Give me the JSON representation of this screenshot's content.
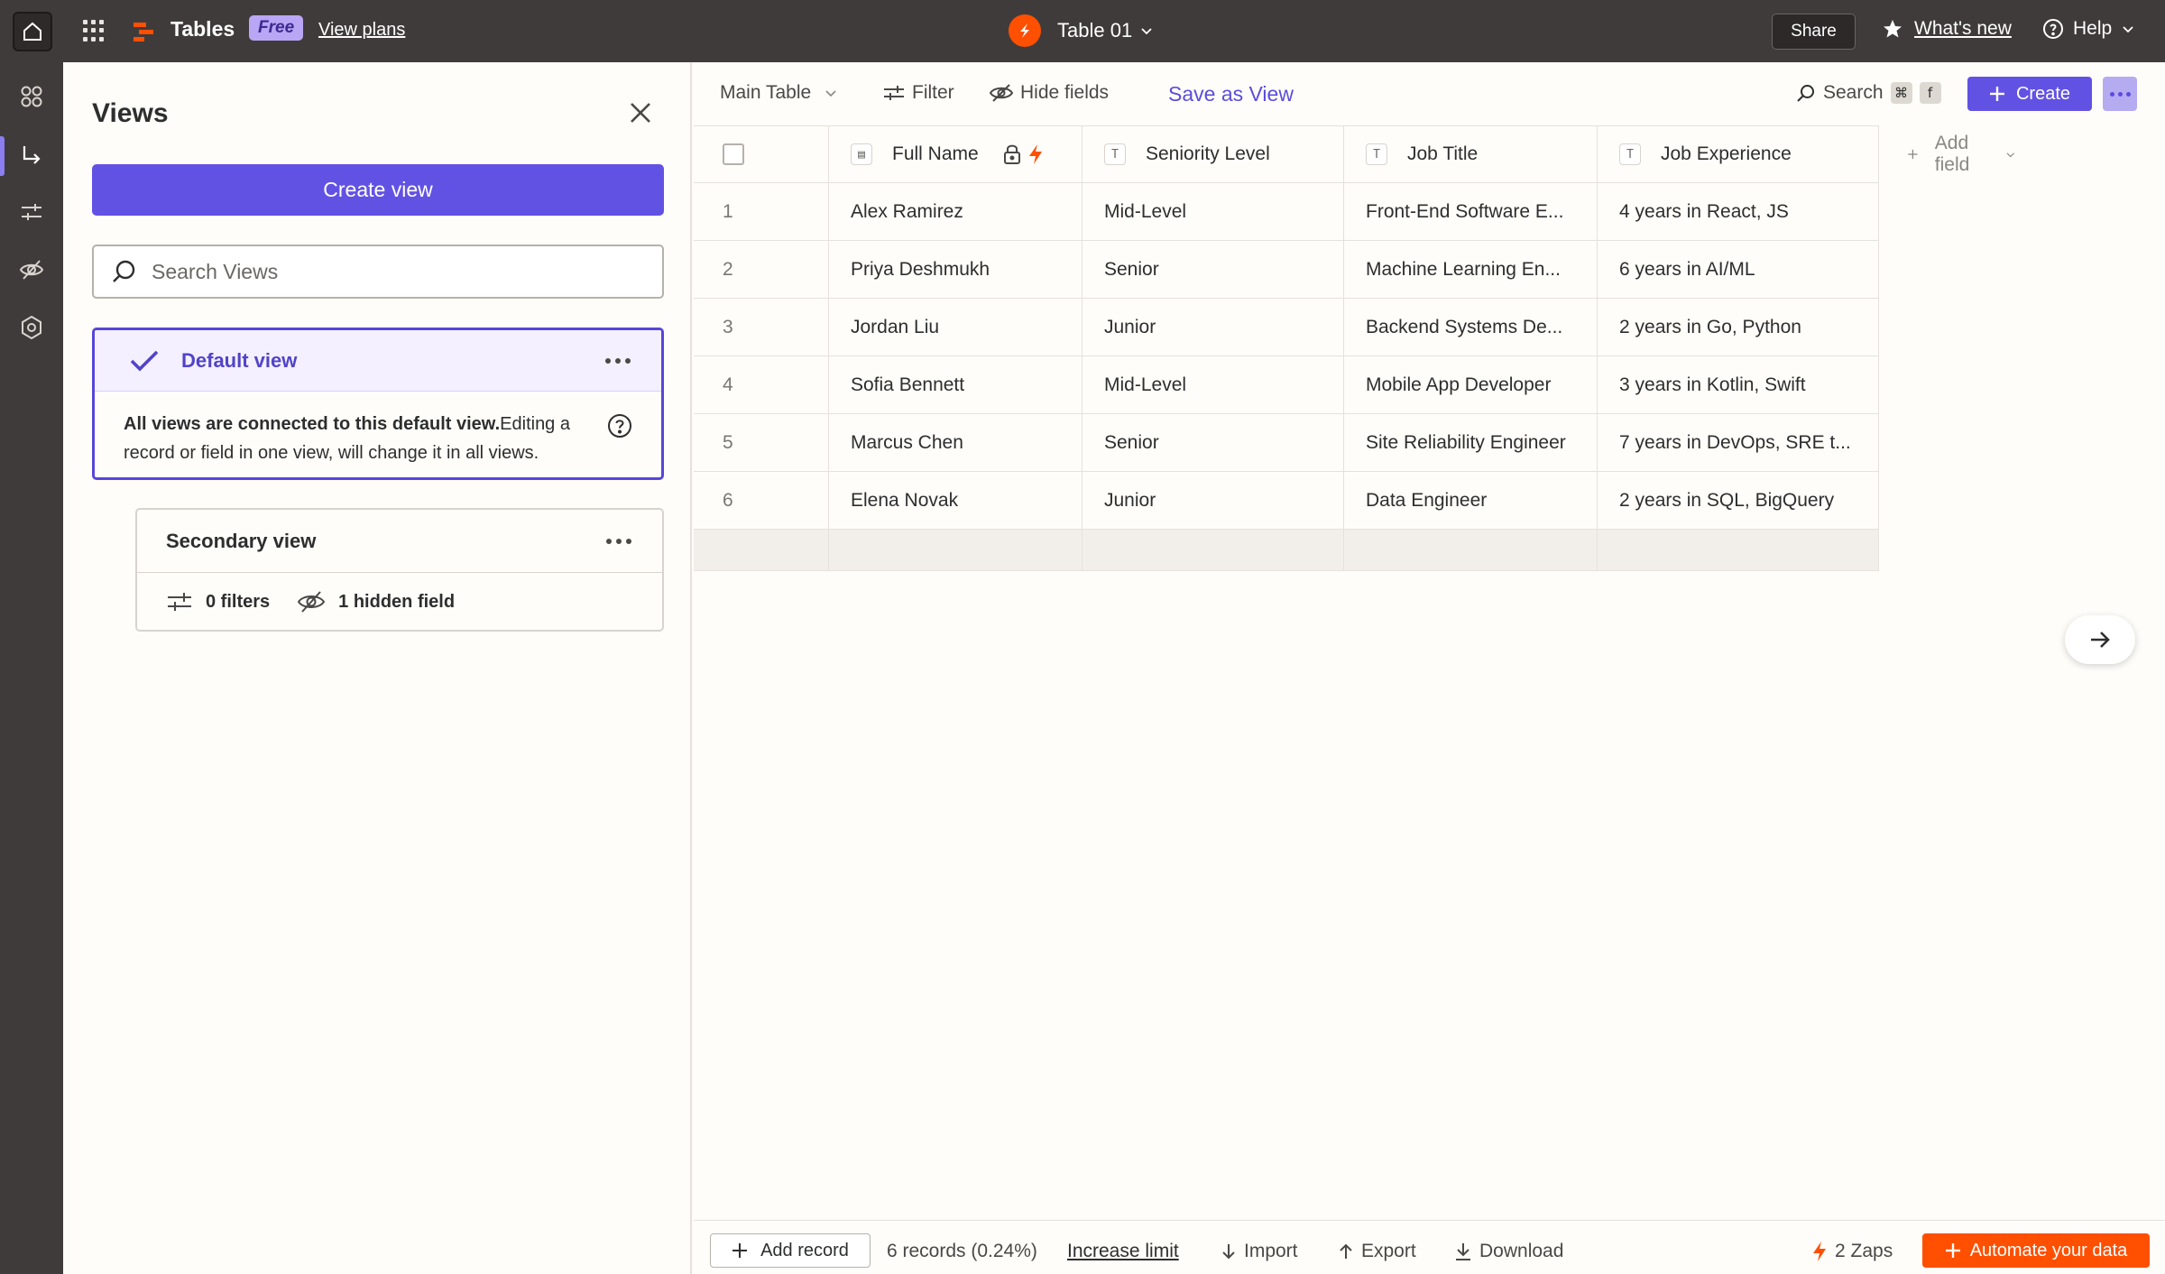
{
  "topbar": {
    "app_name": "Tables",
    "plan_badge": "Free",
    "view_plans": "View plans",
    "table_name": "Table 01",
    "share": "Share",
    "whats_new": "What's new",
    "help": "Help"
  },
  "views_panel": {
    "title": "Views",
    "create_view": "Create view",
    "search_placeholder": "Search Views",
    "default_view": {
      "name": "Default view",
      "info_bold": "All views are connected to this default view.",
      "info_text": "Editing a record or field in one view, will change it in all views."
    },
    "secondary_view": {
      "name": "Secondary view",
      "filters": "0 filters",
      "hidden": "1 hidden field"
    }
  },
  "toolbar": {
    "table_select": "Main Table",
    "filter": "Filter",
    "hide_fields": "Hide fields",
    "save_as_view": "Save as View",
    "search": "Search",
    "kbd_cmd": "⌘",
    "kbd_f": "f",
    "create": "Create"
  },
  "table": {
    "columns": [
      "Full Name",
      "Seniority Level",
      "Job Title",
      "Job Experience"
    ],
    "add_field": "Add field",
    "rows": [
      {
        "num": "1",
        "name": "Alex Ramirez",
        "level": "Mid-Level",
        "title": "Front-End Software E...",
        "exp": "4 years in React, JS"
      },
      {
        "num": "2",
        "name": "Priya Deshmukh",
        "level": "Senior",
        "title": "Machine Learning En...",
        "exp": "6 years in AI/ML"
      },
      {
        "num": "3",
        "name": "Jordan Liu",
        "level": "Junior",
        "title": "Backend Systems De...",
        "exp": "2 years in Go, Python"
      },
      {
        "num": "4",
        "name": "Sofia Bennett",
        "level": "Mid-Level",
        "title": "Mobile App Developer",
        "exp": "3 years in Kotlin, Swift"
      },
      {
        "num": "5",
        "name": "Marcus Chen",
        "level": "Senior",
        "title": "Site Reliability Engineer",
        "exp": "7 years in DevOps, SRE t..."
      },
      {
        "num": "6",
        "name": "Elena Novak",
        "level": "Junior",
        "title": "Data Engineer",
        "exp": "2 years in SQL, BigQuery"
      }
    ]
  },
  "footer": {
    "add_record": "Add record",
    "records": "6 records (0.24%)",
    "increase_limit": "Increase limit",
    "import": "Import",
    "export": "Export",
    "download": "Download",
    "zaps": "2 Zaps",
    "automate": "Automate your data"
  },
  "colors": {
    "accent": "#6252e3",
    "brand_orange": "#ff4f00",
    "topbar_bg": "#403b3b"
  }
}
